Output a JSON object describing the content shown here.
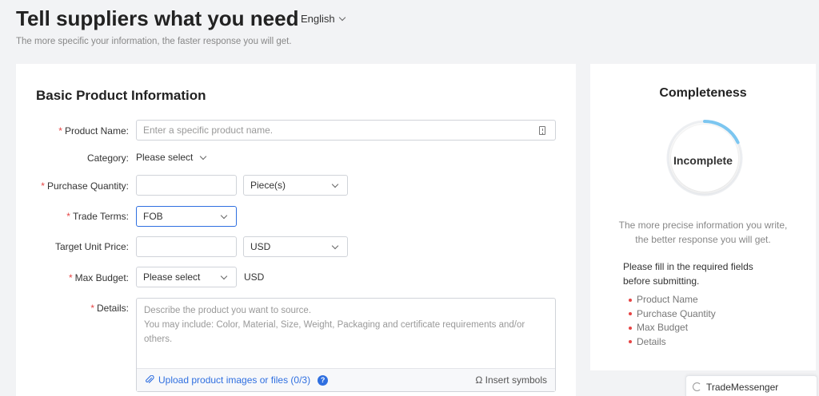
{
  "header": {
    "title": "Tell suppliers what you need",
    "language": "English",
    "subtitle": "The more specific your information, the faster response you will get."
  },
  "form": {
    "section_title": "Basic Product Information",
    "required_mark": "*",
    "product_name": {
      "label": "Product Name:",
      "placeholder": "Enter a specific product name."
    },
    "category": {
      "label": "Category:",
      "value": "Please select"
    },
    "purchase_quantity": {
      "label": "Purchase Quantity:",
      "value": "",
      "unit": "Piece(s)"
    },
    "trade_terms": {
      "label": "Trade Terms:",
      "value": "FOB"
    },
    "target_unit_price": {
      "label": "Target Unit Price:",
      "value": "",
      "currency": "USD"
    },
    "max_budget": {
      "label": "Max Budget:",
      "value": "Please select",
      "currency": "USD"
    },
    "details": {
      "label": "Details:",
      "placeholder_line1": "Describe the product you want to source.",
      "placeholder_line2": "You may include: Color, Material, Size, Weight, Packaging and certificate requirements and/or others.",
      "upload_label": "Upload product images or files (0/3)",
      "help_icon": "?",
      "insert_label": "Ω Insert symbols"
    }
  },
  "completeness": {
    "title": "Completeness",
    "status": "Incomplete",
    "progress": 0.18,
    "accent_color": "#7cc6f0",
    "hint": "The more precise information you write, the better response you will get.",
    "note": "Please fill in the required fields before submitting.",
    "required_fields": [
      "Product Name",
      "Purchase Quantity",
      "Max Budget",
      "Details"
    ]
  },
  "trade_messenger": {
    "label": "TradeMessenger"
  }
}
